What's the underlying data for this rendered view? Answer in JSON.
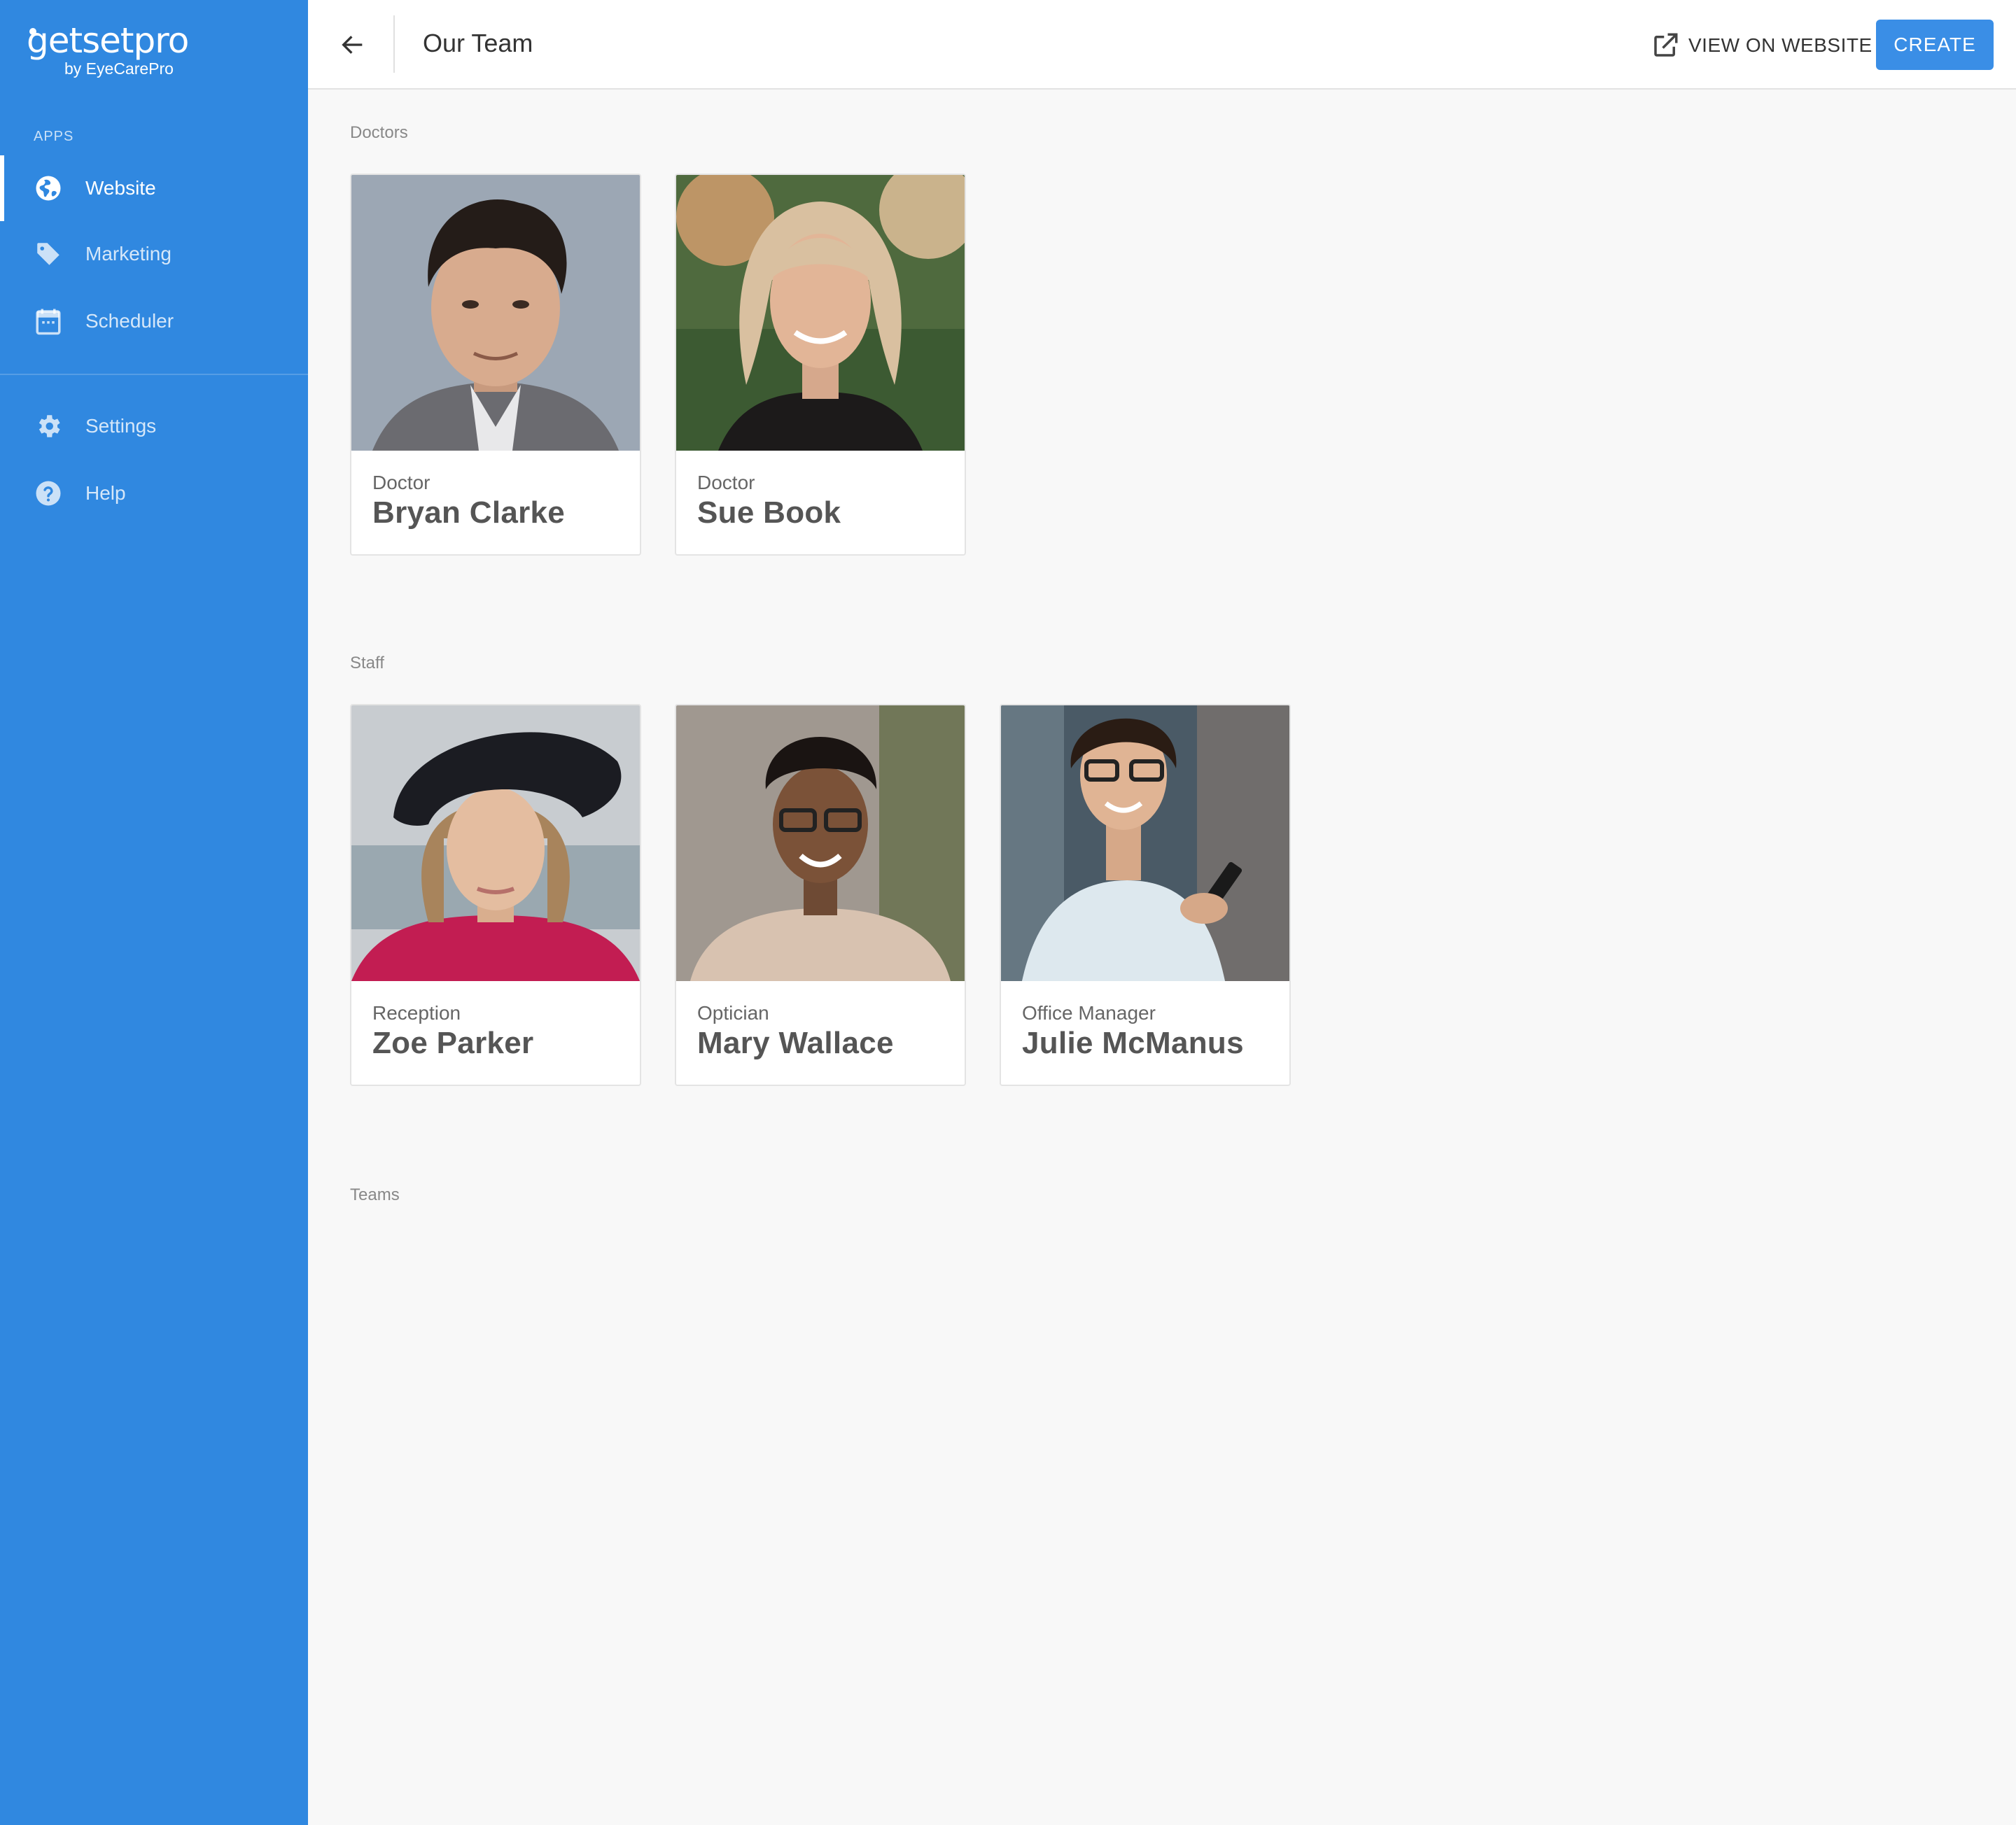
{
  "sidebar": {
    "logo_word": "getsetpro",
    "logo_sub": "by EyeCarePro",
    "section_label": "APPS",
    "items": [
      {
        "label": "Website",
        "icon": "globe-icon",
        "active": true
      },
      {
        "label": "Marketing",
        "icon": "tag-icon",
        "active": false
      },
      {
        "label": "Scheduler",
        "icon": "calendar-icon",
        "active": false
      },
      {
        "label": "Settings",
        "icon": "gear-icon",
        "active": false
      },
      {
        "label": "Help",
        "icon": "help-circle-icon",
        "active": false
      }
    ]
  },
  "header": {
    "title": "Our Team",
    "view_on_website": "VIEW ON WEBSITE",
    "create": "CREATE"
  },
  "groups": {
    "doctors": {
      "label": "Doctors",
      "members": [
        {
          "role": "Doctor",
          "name": "Bryan Clarke"
        },
        {
          "role": "Doctor",
          "name": "Sue Book"
        }
      ]
    },
    "staff": {
      "label": "Staff",
      "members": [
        {
          "role": "Reception",
          "name": "Zoe Parker"
        },
        {
          "role": "Optician",
          "name": "Mary Wallace"
        },
        {
          "role": "Office Manager",
          "name": "Julie McManus"
        }
      ]
    },
    "teams": {
      "label": "Teams",
      "members": []
    }
  },
  "colors": {
    "sidebar_bg": "#3088e0",
    "primary_button": "#3a8ee6",
    "page_bg": "#f8f8f8"
  }
}
